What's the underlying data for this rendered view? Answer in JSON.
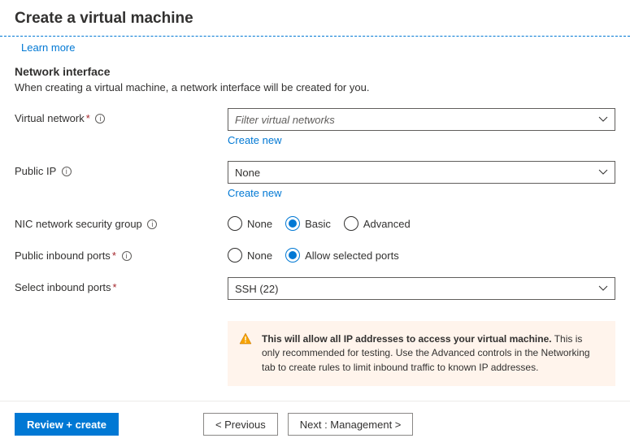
{
  "header": {
    "title": "Create a virtual machine"
  },
  "learn_more": "Learn more",
  "section": {
    "title": "Network interface",
    "desc": "When creating a virtual machine, a network interface will be created for you."
  },
  "fields": {
    "vnet": {
      "label": "Virtual network",
      "placeholder": "Filter virtual networks",
      "create_new": "Create new"
    },
    "public_ip": {
      "label": "Public IP",
      "value": "None",
      "create_new": "Create new"
    },
    "nsg": {
      "label": "NIC network security group",
      "options": {
        "none": "None",
        "basic": "Basic",
        "advanced": "Advanced"
      },
      "selected": "basic"
    },
    "inbound_ports": {
      "label": "Public inbound ports",
      "options": {
        "none": "None",
        "allow": "Allow selected ports"
      },
      "selected": "allow"
    },
    "select_ports": {
      "label": "Select inbound ports",
      "value": "SSH (22)"
    }
  },
  "warning": {
    "bold": "This will allow all IP addresses to access your virtual machine.",
    "rest": "  This is only recommended for testing.  Use the Advanced controls in the Networking tab to create rules to limit inbound traffic to known IP addresses."
  },
  "footer": {
    "review": "Review + create",
    "previous": "<  Previous",
    "next": "Next : Management  >"
  }
}
